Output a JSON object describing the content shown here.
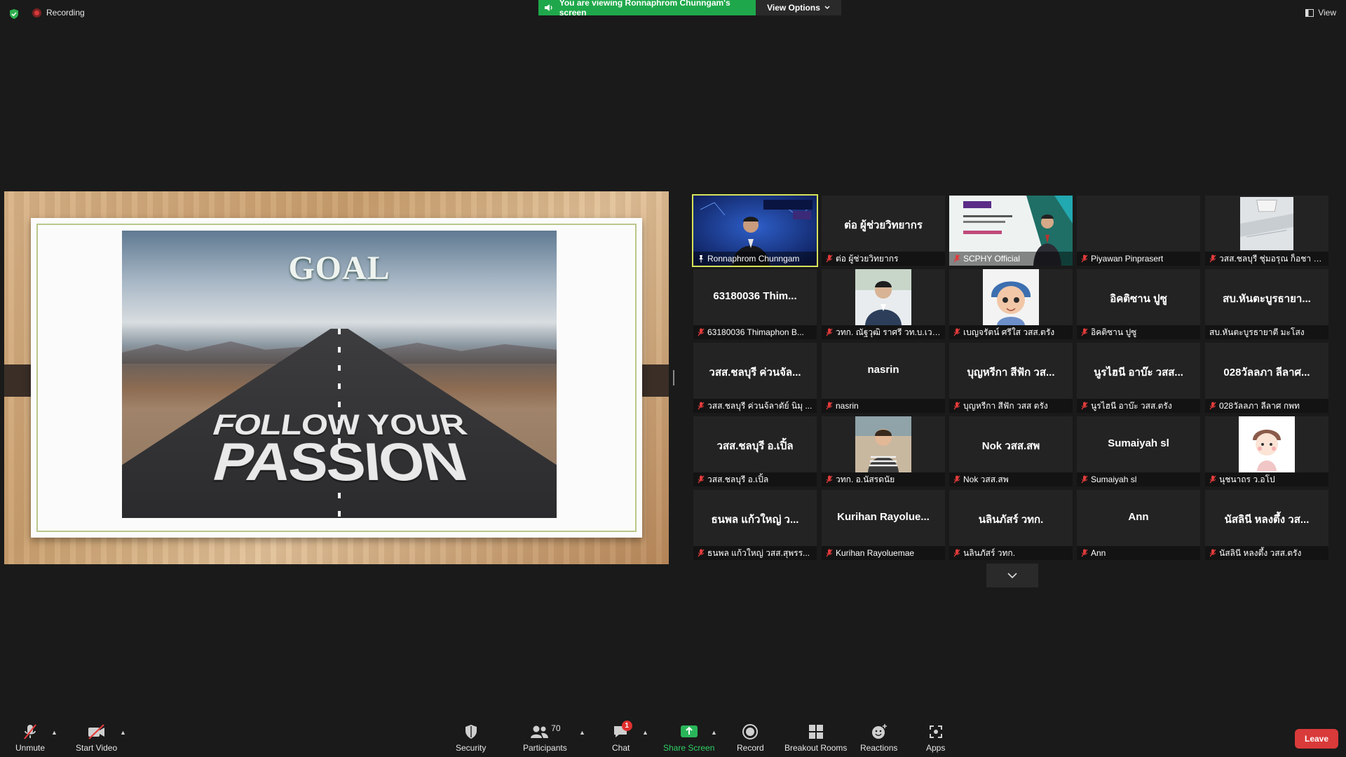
{
  "topbar": {
    "recording_label": "Recording",
    "viewing_banner": "You are viewing Ronnaphrom Chunngam's screen",
    "view_options_label": "View Options",
    "view_label": "View"
  },
  "slide": {
    "heading": "GOAL",
    "line1": "FOLLOW YOUR",
    "line2": "PASSION"
  },
  "gallery": {
    "rows": [
      [
        {
          "display": "",
          "name": "Ronnaphrom Chunngam",
          "media": "video-speaker",
          "active": true,
          "mic": "pinned"
        },
        {
          "display": "ต่อ ผู้ช่วยวิทยากร",
          "name": "ต่อ ผู้ช่วยวิทยากร",
          "media": "none",
          "mic": "muted"
        },
        {
          "display": "",
          "name": "SCPHY Official",
          "media": "video-poster",
          "mic": "muted"
        },
        {
          "display": "",
          "name": "Piyawan Pinprasert",
          "media": "none",
          "mic": "muted"
        },
        {
          "display": "",
          "name": "วสส.ชลบุรี ชุ่มอรุณ ก็อชา ห้...",
          "media": "photo-ceiling",
          "mic": "muted"
        }
      ],
      [
        {
          "display": "63180036 Thim...",
          "name": "63180036 Thimaphon B...",
          "media": "none",
          "mic": "muted"
        },
        {
          "display": "",
          "name": "วทก. ณัฐวุฒิ ราศรี วท.บ.เวช...",
          "media": "photo-man",
          "mic": "muted"
        },
        {
          "display": "",
          "name": "เบญจรัตน์ ศรีใส วสส.ตรัง",
          "media": "photo-cartoon",
          "mic": "muted"
        },
        {
          "display": "อิคติซาน ปูซู",
          "name": "อิคติซาน ปูซู",
          "media": "none",
          "mic": "muted"
        },
        {
          "display": "สบ.หันตะบูรธายา...",
          "name": "สบ.หันตะบูรธายาตี มะโสง",
          "media": "none",
          "mic": "none"
        }
      ],
      [
        {
          "display": "วสส.ชลบุรี ค่วนจัล...",
          "name": "วสส.ชลบุรี ค่วนจ้ลาตัย์ นิมุ ...",
          "media": "none",
          "mic": "muted"
        },
        {
          "display": "nasrin",
          "name": "nasrin",
          "media": "none",
          "mic": "muted"
        },
        {
          "display": "บุญหรีกา สีฟัก วส...",
          "name": "บุญหรีกา สีฟัก วสส ตรัง",
          "media": "none",
          "mic": "muted"
        },
        {
          "display": "นูรไฮนี อาบ๊ะ วสส...",
          "name": "นูรไฮนี อาบ๊ะ วสส.ตรัง",
          "media": "none",
          "mic": "muted"
        },
        {
          "display": "028วัลลภา ลีลาศ...",
          "name": "028วัลลภา ลีลาศ กพท",
          "media": "none",
          "mic": "muted"
        }
      ],
      [
        {
          "display": "วสส.ชลบุรี อ.เปิ้ล",
          "name": "วสส.ชลบุรี อ.เปิ้ล",
          "media": "none",
          "mic": "muted"
        },
        {
          "display": "",
          "name": "วทก. อ.นัสรดนัย",
          "media": "photo-child",
          "mic": "muted"
        },
        {
          "display": "Nok วสส.สพ",
          "name": "Nok วสส.สพ",
          "media": "none",
          "mic": "muted"
        },
        {
          "display": "Sumaiyah sl",
          "name": "Sumaiyah sl",
          "media": "none",
          "mic": "muted"
        },
        {
          "display": "",
          "name": "นุชนาถร ว.อโป",
          "media": "photo-doll",
          "mic": "muted"
        }
      ],
      [
        {
          "display": "ธนพล แก้วใหญ่ ว...",
          "name": "ธนพล แก้วใหญ่ วสส.สุพรร...",
          "media": "none",
          "mic": "muted"
        },
        {
          "display": "Kurihan Rayolue...",
          "name": "Kurihan Rayoluemae",
          "media": "none",
          "mic": "muted"
        },
        {
          "display": "นลินภัสร์ วทก.",
          "name": "นลินภัสร์ วทก.",
          "media": "none",
          "mic": "muted"
        },
        {
          "display": "Ann",
          "name": "Ann",
          "media": "none",
          "mic": "muted"
        },
        {
          "display": "นัสลินี หลงตึ้ง วส...",
          "name": "นัสลินี หลงตึ้ง วสส.ตรัง",
          "media": "none",
          "mic": "muted"
        }
      ]
    ]
  },
  "toolbar": {
    "unmute": "Unmute",
    "start_video": "Start Video",
    "security": "Security",
    "participants": "Participants",
    "participants_count": "70",
    "chat": "Chat",
    "chat_badge": "1",
    "share_screen": "Share Screen",
    "record": "Record",
    "breakout_rooms": "Breakout Rooms",
    "reactions": "Reactions",
    "apps": "Apps",
    "leave": "Leave"
  },
  "colors": {
    "background": "#1a1a1a",
    "banner_green": "#1fa84b",
    "active_speaker": "#d7e35a",
    "muted_red": "#e23b3b",
    "leave_red": "#d93a3a"
  }
}
